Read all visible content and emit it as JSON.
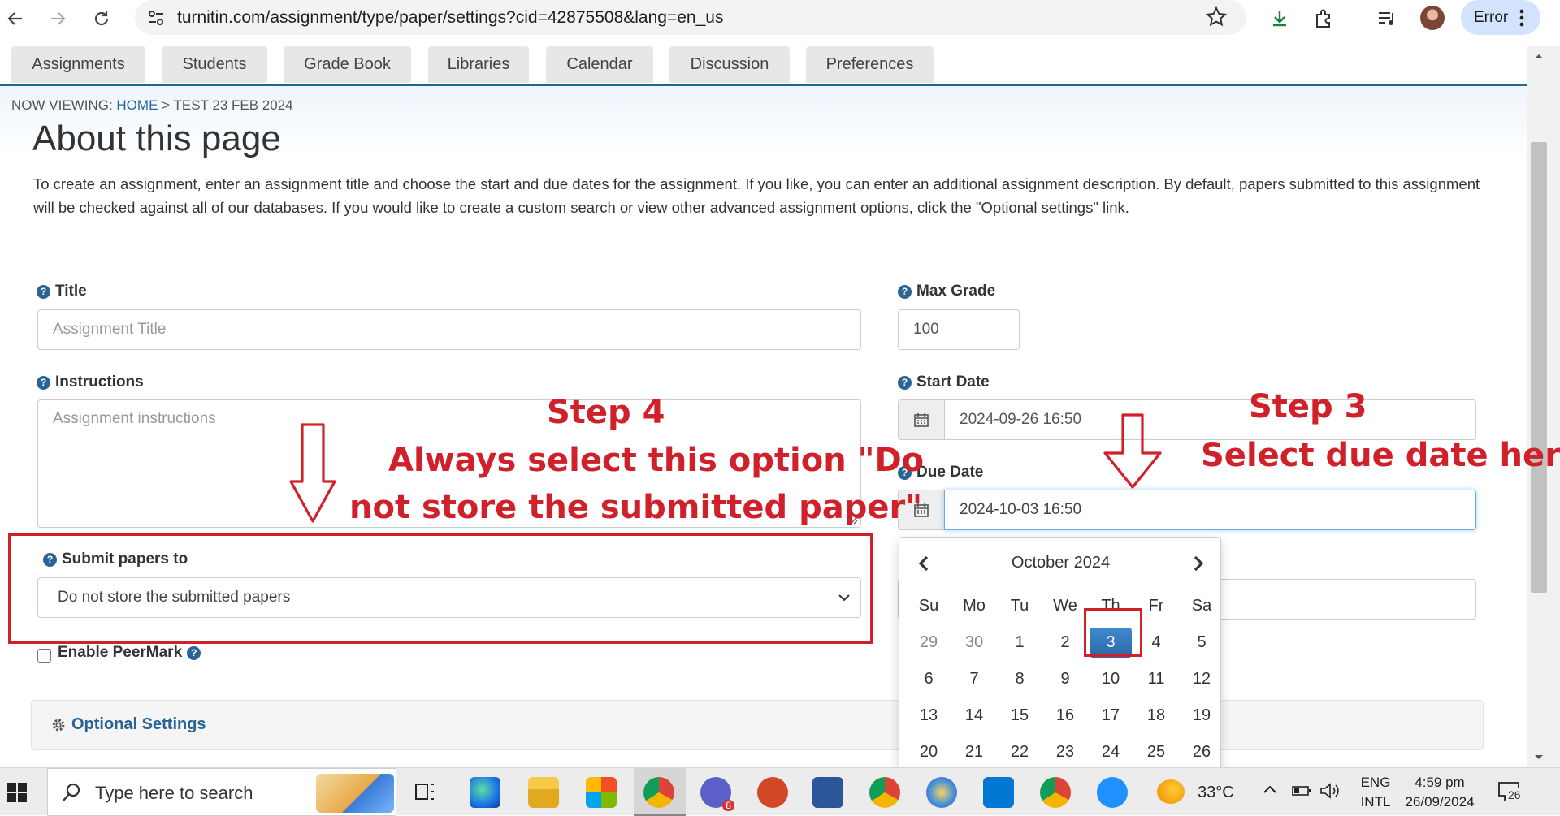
{
  "browser": {
    "url": "turnitin.com/assignment/type/paper/settings?cid=42875508&lang=en_us",
    "error_label": "Error"
  },
  "tabs": [
    "Assignments",
    "Students",
    "Grade Book",
    "Libraries",
    "Calendar",
    "Discussion",
    "Preferences"
  ],
  "breadcrumb": {
    "prefix": "NOW VIEWING:",
    "home": "HOME",
    "separator": ">",
    "current": "TEST 23 FEB 2024"
  },
  "page": {
    "heading": "About this page",
    "intro": "To create an assignment, enter an assignment title and choose the start and due dates for the assignment. If you like, you can enter an additional assignment description. By default, papers submitted to this assignment will be checked against all of our databases. If you would like to create a custom search or view other advanced assignment options, click the \"Optional settings\" link."
  },
  "form": {
    "title_label": "Title",
    "title_placeholder": "Assignment Title",
    "instructions_label": "Instructions",
    "instructions_placeholder": "Assignment instructions",
    "submit_label": "Submit papers to",
    "submit_value": "Do not store the submitted papers",
    "peermark_label": "Enable PeerMark",
    "max_grade_label": "Max Grade",
    "max_grade_value": "100",
    "start_date_label": "Start Date",
    "start_date_value": "2024-09-26 16:50",
    "due_date_label": "Due Date",
    "due_date_value": "2024-10-03 16:50",
    "optional_label": "Optional Settings"
  },
  "datepicker": {
    "month_label": "October 2024",
    "weekdays": [
      "Su",
      "Mo",
      "Tu",
      "We",
      "Th",
      "Fr",
      "Sa"
    ],
    "days": [
      "29",
      "30",
      "1",
      "2",
      "3",
      "4",
      "5",
      "6",
      "7",
      "8",
      "9",
      "10",
      "11",
      "12",
      "13",
      "14",
      "15",
      "16",
      "17",
      "18",
      "19",
      "20",
      "21",
      "22",
      "23",
      "24",
      "25",
      "26"
    ],
    "selected_day": "3",
    "outside_month_count": 2
  },
  "annotations": {
    "step4_title": "Step 4",
    "step4_line1": "Always select this option \"Do",
    "step4_line2": "not store the submitted paper\"",
    "step3_title": "Step 3",
    "step3_line1": "Select due date here",
    "color": "#d0202a"
  },
  "taskbar": {
    "search_placeholder": "Type here to search",
    "weather": "33°C",
    "lang_top": "ENG",
    "lang_bottom": "INTL",
    "time": "4:59 pm",
    "date": "26/09/2024",
    "notification_count": "26",
    "outlook_badge": "8"
  }
}
